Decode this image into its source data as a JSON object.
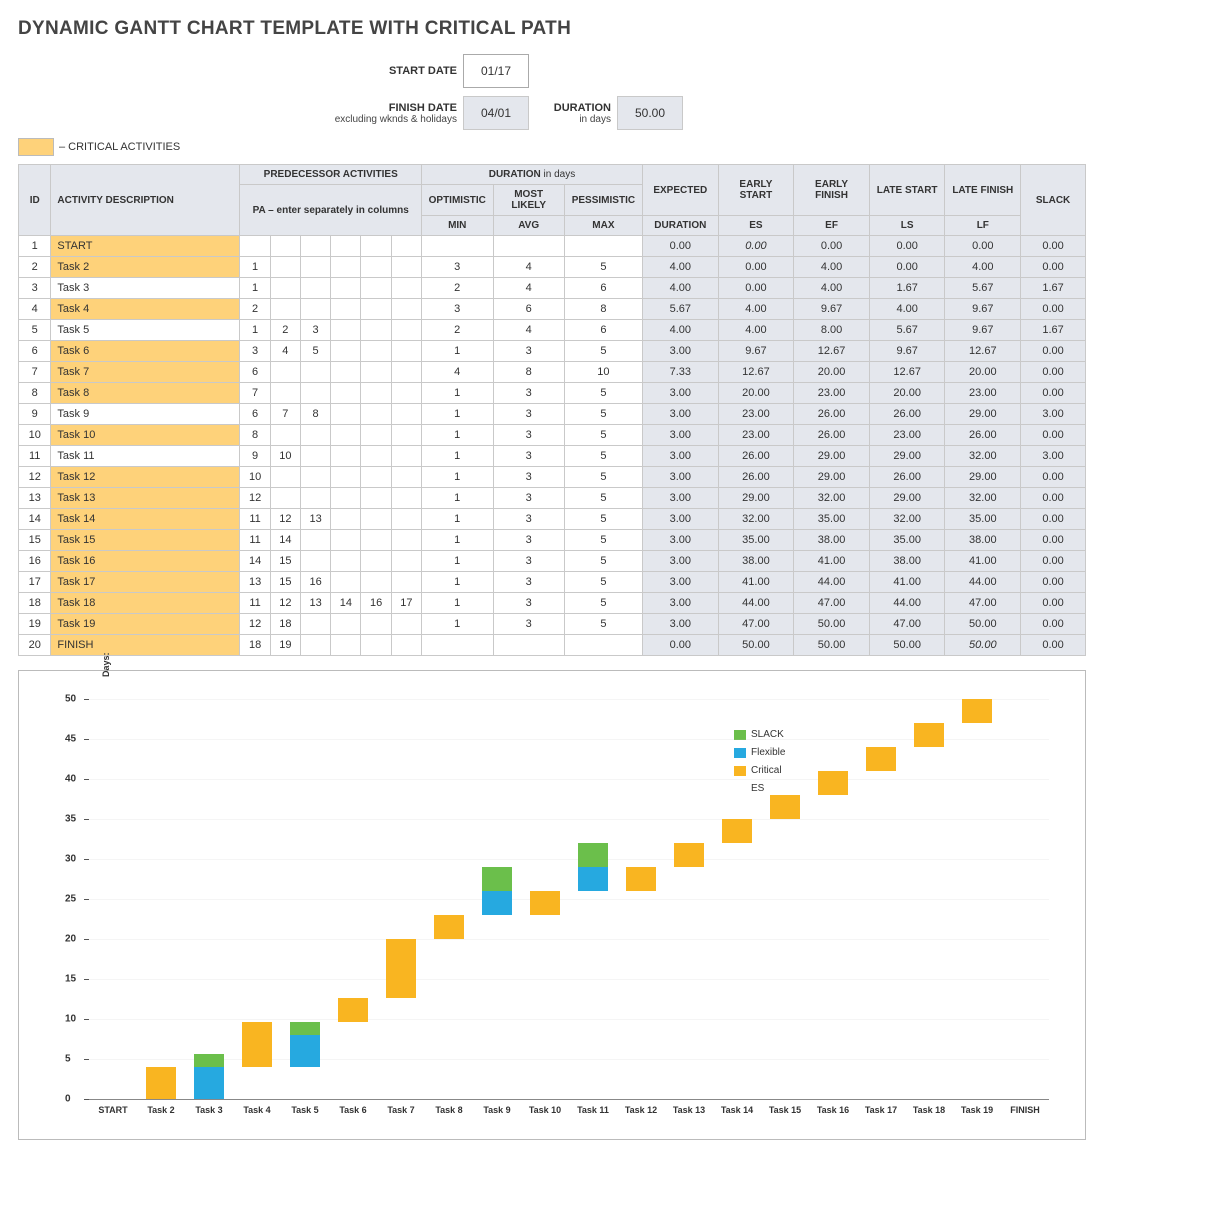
{
  "title": "DYNAMIC GANTT CHART TEMPLATE WITH CRITICAL PATH",
  "form": {
    "start_label": "START DATE",
    "start_value": "01/17",
    "finish_label": "FINISH DATE",
    "finish_sub": "excluding wknds & holidays",
    "finish_value": "04/01",
    "duration_label": "DURATION",
    "duration_sub": "in days",
    "duration_value": "50.00"
  },
  "legend": {
    "critical": "– CRITICAL ACTIVITIES"
  },
  "headers": {
    "id": "ID",
    "act": "ACTIVITY DESCRIPTION",
    "pa_group": "PREDECESSOR ACTIVITIES",
    "pa_sub": "PA  –  enter separately in columns",
    "dur_group_a": "DURATION",
    "dur_group_b": " in days",
    "opt": "OPTIMISTIC",
    "opt_sub": "MIN",
    "ml": "MOST LIKELY",
    "ml_sub": "AVG",
    "pes": "PESSIMISTIC",
    "pes_sub": "MAX",
    "exp": "EXPECTED",
    "exp_sub": "DURATION",
    "es": "EARLY START",
    "es_sub": "ES",
    "ef": "EARLY FINISH",
    "ef_sub": "EF",
    "ls": "LATE START",
    "ls_sub": "LS",
    "lf": "LATE FINISH",
    "lf_sub": "LF",
    "slack": "SLACK"
  },
  "rows": [
    {
      "id": 1,
      "act": "START",
      "crit": true,
      "pa": [
        "",
        "",
        "",
        "",
        "",
        ""
      ],
      "min": "",
      "avg": "",
      "max": "",
      "dur": "0.00",
      "es": "0.00",
      "ef": "0.00",
      "ls": "0.00",
      "lf": "0.00",
      "slack": "0.00",
      "es_ital": true
    },
    {
      "id": 2,
      "act": "Task 2",
      "crit": true,
      "pa": [
        "1",
        "",
        "",
        "",
        "",
        ""
      ],
      "min": "3",
      "avg": "4",
      "max": "5",
      "dur": "4.00",
      "es": "0.00",
      "ef": "4.00",
      "ls": "0.00",
      "lf": "4.00",
      "slack": "0.00"
    },
    {
      "id": 3,
      "act": "Task 3",
      "crit": false,
      "pa": [
        "1",
        "",
        "",
        "",
        "",
        ""
      ],
      "min": "2",
      "avg": "4",
      "max": "6",
      "dur": "4.00",
      "es": "0.00",
      "ef": "4.00",
      "ls": "1.67",
      "lf": "5.67",
      "slack": "1.67"
    },
    {
      "id": 4,
      "act": "Task 4",
      "crit": true,
      "pa": [
        "2",
        "",
        "",
        "",
        "",
        ""
      ],
      "min": "3",
      "avg": "6",
      "max": "8",
      "dur": "5.67",
      "es": "4.00",
      "ef": "9.67",
      "ls": "4.00",
      "lf": "9.67",
      "slack": "0.00"
    },
    {
      "id": 5,
      "act": "Task 5",
      "crit": false,
      "pa": [
        "1",
        "2",
        "3",
        "",
        "",
        ""
      ],
      "min": "2",
      "avg": "4",
      "max": "6",
      "dur": "4.00",
      "es": "4.00",
      "ef": "8.00",
      "ls": "5.67",
      "lf": "9.67",
      "slack": "1.67"
    },
    {
      "id": 6,
      "act": "Task 6",
      "crit": true,
      "pa": [
        "3",
        "4",
        "5",
        "",
        "",
        ""
      ],
      "min": "1",
      "avg": "3",
      "max": "5",
      "dur": "3.00",
      "es": "9.67",
      "ef": "12.67",
      "ls": "9.67",
      "lf": "12.67",
      "slack": "0.00"
    },
    {
      "id": 7,
      "act": "Task 7",
      "crit": true,
      "pa": [
        "6",
        "",
        "",
        "",
        "",
        ""
      ],
      "min": "4",
      "avg": "8",
      "max": "10",
      "dur": "7.33",
      "es": "12.67",
      "ef": "20.00",
      "ls": "12.67",
      "lf": "20.00",
      "slack": "0.00"
    },
    {
      "id": 8,
      "act": "Task 8",
      "crit": true,
      "pa": [
        "7",
        "",
        "",
        "",
        "",
        ""
      ],
      "min": "1",
      "avg": "3",
      "max": "5",
      "dur": "3.00",
      "es": "20.00",
      "ef": "23.00",
      "ls": "20.00",
      "lf": "23.00",
      "slack": "0.00"
    },
    {
      "id": 9,
      "act": "Task 9",
      "crit": false,
      "pa": [
        "6",
        "7",
        "8",
        "",
        "",
        ""
      ],
      "min": "1",
      "avg": "3",
      "max": "5",
      "dur": "3.00",
      "es": "23.00",
      "ef": "26.00",
      "ls": "26.00",
      "lf": "29.00",
      "slack": "3.00"
    },
    {
      "id": 10,
      "act": "Task 10",
      "crit": true,
      "pa": [
        "8",
        "",
        "",
        "",
        "",
        ""
      ],
      "min": "1",
      "avg": "3",
      "max": "5",
      "dur": "3.00",
      "es": "23.00",
      "ef": "26.00",
      "ls": "23.00",
      "lf": "26.00",
      "slack": "0.00"
    },
    {
      "id": 11,
      "act": "Task 11",
      "crit": false,
      "pa": [
        "9",
        "10",
        "",
        "",
        "",
        ""
      ],
      "min": "1",
      "avg": "3",
      "max": "5",
      "dur": "3.00",
      "es": "26.00",
      "ef": "29.00",
      "ls": "29.00",
      "lf": "32.00",
      "slack": "3.00"
    },
    {
      "id": 12,
      "act": "Task 12",
      "crit": true,
      "pa": [
        "10",
        "",
        "",
        "",
        "",
        ""
      ],
      "min": "1",
      "avg": "3",
      "max": "5",
      "dur": "3.00",
      "es": "26.00",
      "ef": "29.00",
      "ls": "26.00",
      "lf": "29.00",
      "slack": "0.00"
    },
    {
      "id": 13,
      "act": "Task 13",
      "crit": true,
      "pa": [
        "12",
        "",
        "",
        "",
        "",
        ""
      ],
      "min": "1",
      "avg": "3",
      "max": "5",
      "dur": "3.00",
      "es": "29.00",
      "ef": "32.00",
      "ls": "29.00",
      "lf": "32.00",
      "slack": "0.00"
    },
    {
      "id": 14,
      "act": "Task 14",
      "crit": true,
      "pa": [
        "11",
        "12",
        "13",
        "",
        "",
        ""
      ],
      "min": "1",
      "avg": "3",
      "max": "5",
      "dur": "3.00",
      "es": "32.00",
      "ef": "35.00",
      "ls": "32.00",
      "lf": "35.00",
      "slack": "0.00"
    },
    {
      "id": 15,
      "act": "Task 15",
      "crit": true,
      "pa": [
        "11",
        "14",
        "",
        "",
        "",
        ""
      ],
      "min": "1",
      "avg": "3",
      "max": "5",
      "dur": "3.00",
      "es": "35.00",
      "ef": "38.00",
      "ls": "35.00",
      "lf": "38.00",
      "slack": "0.00"
    },
    {
      "id": 16,
      "act": "Task 16",
      "crit": true,
      "pa": [
        "14",
        "15",
        "",
        "",
        "",
        ""
      ],
      "min": "1",
      "avg": "3",
      "max": "5",
      "dur": "3.00",
      "es": "38.00",
      "ef": "41.00",
      "ls": "38.00",
      "lf": "41.00",
      "slack": "0.00"
    },
    {
      "id": 17,
      "act": "Task 17",
      "crit": true,
      "pa": [
        "13",
        "15",
        "16",
        "",
        "",
        ""
      ],
      "min": "1",
      "avg": "3",
      "max": "5",
      "dur": "3.00",
      "es": "41.00",
      "ef": "44.00",
      "ls": "41.00",
      "lf": "44.00",
      "slack": "0.00"
    },
    {
      "id": 18,
      "act": "Task 18",
      "crit": true,
      "pa": [
        "11",
        "12",
        "13",
        "14",
        "16",
        "17"
      ],
      "min": "1",
      "avg": "3",
      "max": "5",
      "dur": "3.00",
      "es": "44.00",
      "ef": "47.00",
      "ls": "44.00",
      "lf": "47.00",
      "slack": "0.00"
    },
    {
      "id": 19,
      "act": "Task 19",
      "crit": true,
      "pa": [
        "12",
        "18",
        "",
        "",
        "",
        ""
      ],
      "min": "1",
      "avg": "3",
      "max": "5",
      "dur": "3.00",
      "es": "47.00",
      "ef": "50.00",
      "ls": "47.00",
      "lf": "50.00",
      "slack": "0.00"
    },
    {
      "id": 20,
      "act": "FINISH",
      "crit": true,
      "pa": [
        "18",
        "19",
        "",
        "",
        "",
        ""
      ],
      "min": "",
      "avg": "",
      "max": "",
      "dur": "0.00",
      "es": "50.00",
      "ef": "50.00",
      "ls": "50.00",
      "lf": "50.00",
      "slack": "0.00",
      "lf_ital": true
    }
  ],
  "chart_legend": {
    "slack": "SLACK",
    "flexible": "Flexible",
    "critical": "Critical",
    "es": "ES"
  },
  "chart_yunit": "Days:",
  "chart_data": {
    "type": "bar",
    "ylabel": "Days:",
    "ylim": [
      0,
      50
    ],
    "yticks": [
      0,
      5,
      10,
      15,
      20,
      25,
      30,
      35,
      40,
      45,
      50
    ],
    "categories": [
      "START",
      "Task 2",
      "Task 3",
      "Task 4",
      "Task 5",
      "Task 6",
      "Task 7",
      "Task 8",
      "Task 9",
      "Task 10",
      "Task 11",
      "Task 12",
      "Task 13",
      "Task 14",
      "Task 15",
      "Task 16",
      "Task 17",
      "Task 18",
      "Task 19",
      "FINISH"
    ],
    "series": [
      {
        "name": "ES",
        "role": "offset",
        "values": [
          0,
          0,
          0,
          4,
          4,
          9.67,
          12.67,
          20,
          23,
          23,
          26,
          26,
          29,
          32,
          35,
          38,
          41,
          44,
          47,
          50
        ]
      },
      {
        "name": "Critical",
        "values": [
          0,
          4,
          0,
          5.67,
          0,
          3,
          7.33,
          3,
          0,
          3,
          0,
          3,
          3,
          3,
          3,
          3,
          3,
          3,
          3,
          0
        ]
      },
      {
        "name": "Flexible",
        "values": [
          0,
          0,
          4,
          0,
          4,
          0,
          0,
          0,
          3,
          0,
          3,
          0,
          0,
          0,
          0,
          0,
          0,
          0,
          0,
          0
        ]
      },
      {
        "name": "SLACK",
        "values": [
          0,
          0,
          1.67,
          0,
          1.67,
          0,
          0,
          0,
          3,
          0,
          3,
          0,
          0,
          0,
          0,
          0,
          0,
          0,
          0,
          0
        ]
      }
    ],
    "legend": [
      "SLACK",
      "Flexible",
      "Critical",
      "ES"
    ]
  }
}
